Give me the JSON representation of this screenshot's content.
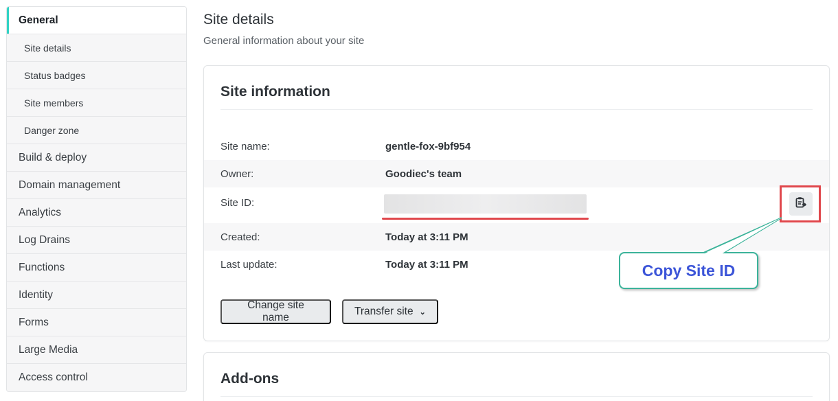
{
  "sidebar": {
    "items": [
      {
        "label": "General"
      },
      {
        "label": "Site details"
      },
      {
        "label": "Status badges"
      },
      {
        "label": "Site members"
      },
      {
        "label": "Danger zone"
      },
      {
        "label": "Build & deploy"
      },
      {
        "label": "Domain management"
      },
      {
        "label": "Analytics"
      },
      {
        "label": "Log Drains"
      },
      {
        "label": "Functions"
      },
      {
        "label": "Identity"
      },
      {
        "label": "Forms"
      },
      {
        "label": "Large Media"
      },
      {
        "label": "Access control"
      }
    ]
  },
  "page": {
    "title": "Site details",
    "subtitle": "General information about your site"
  },
  "site_information": {
    "title": "Site information",
    "rows": [
      {
        "label": "Site name:",
        "value": "gentle-fox-9bf954"
      },
      {
        "label": "Owner:",
        "value": "Goodiec's team"
      },
      {
        "label": "Site ID:",
        "value": ""
      },
      {
        "label": "Created:",
        "value": "Today at 3:11 PM"
      },
      {
        "label": "Last update:",
        "value": "Today at 3:11 PM"
      }
    ],
    "copy_icon": "clipboard-copy-icon",
    "buttons": {
      "change_site_name": "Change site name",
      "transfer_site": "Transfer site"
    }
  },
  "addons": {
    "title": "Add-ons"
  },
  "annotation": {
    "callout_text": "Copy Site ID",
    "highlight_color": "#e0474c",
    "callout_border_color": "#3bb39a",
    "callout_text_color": "#3c55d8"
  },
  "colors": {
    "active_accent": "#31d3c4"
  }
}
